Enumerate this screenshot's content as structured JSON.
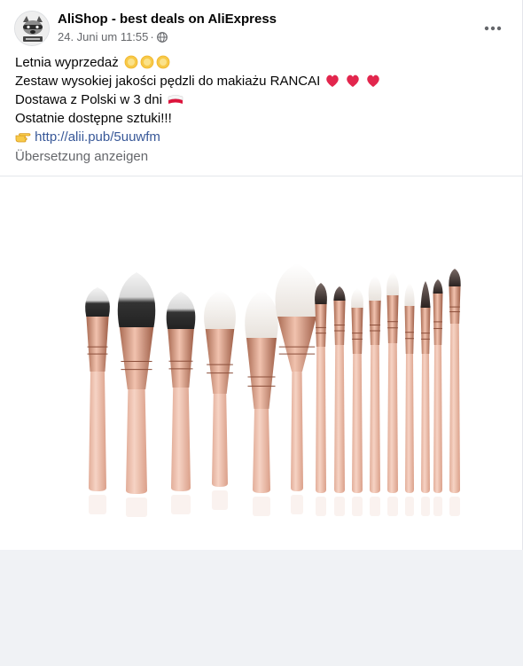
{
  "post": {
    "page_name": "AliShop - best deals on AliExpress",
    "timestamp": "24. Juni um 11:55",
    "separator": "·",
    "privacy_icon": "globe-icon",
    "more_icon": "more-options-icon",
    "lines": {
      "l1": "Letnia wyprzedaż",
      "l2": "Zestaw wysokiej jakości pędzli do makiażu RANCAI",
      "l3": "Dostawa z Polski w 3 dni",
      "l4": "Ostatnie dostępne sztuki!!!",
      "link_icon": "pointing-hand-icon",
      "link": "http://alii.pub/5uuwfm"
    },
    "translate_label": "Übersetzung anzeigen",
    "image": {
      "subject": "makeup-brush-set",
      "brush_count": 15,
      "colors": {
        "handle": "#f0c6b4",
        "ferrule": "#c98d74"
      }
    }
  },
  "colors": {
    "link": "#385898",
    "secondary_text": "#65676b",
    "heart": "#e2264d",
    "sun": "#f7c948",
    "background": "#f0f2f5"
  }
}
